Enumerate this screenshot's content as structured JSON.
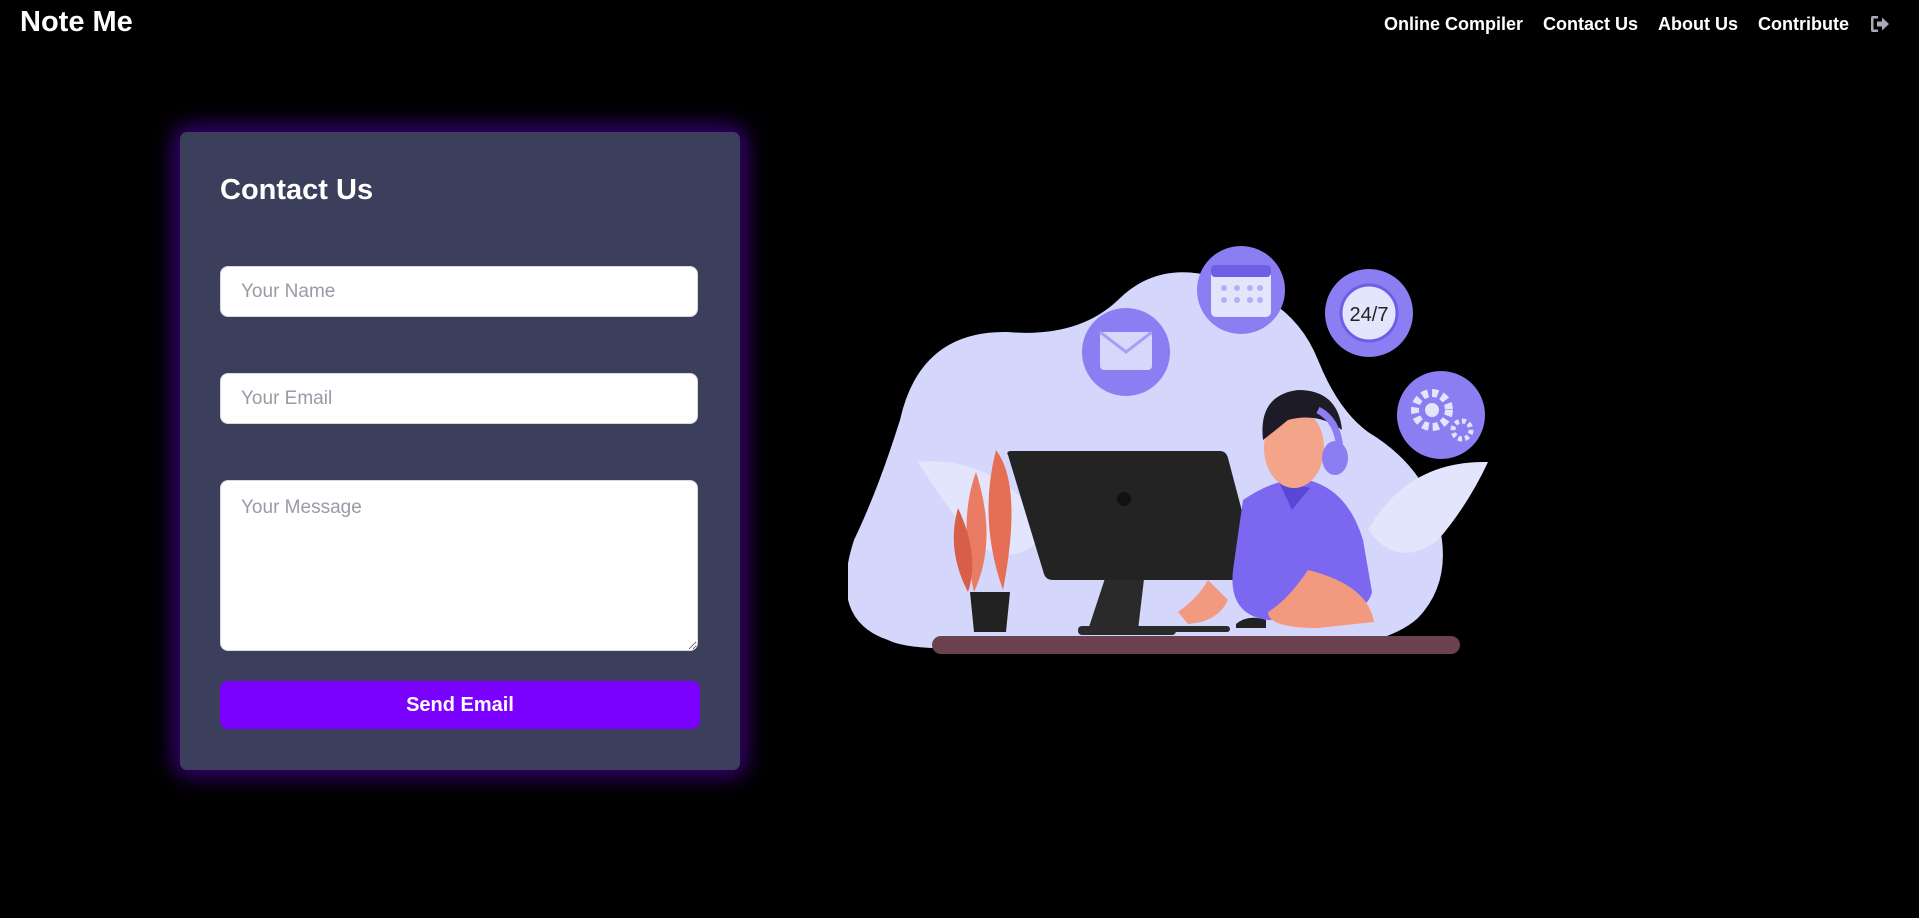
{
  "header": {
    "brand": "Note Me",
    "nav": [
      {
        "label": "Online Compiler"
      },
      {
        "label": "Contact Us"
      },
      {
        "label": "About Us"
      },
      {
        "label": "Contribute"
      }
    ],
    "logout_icon": "sign-out-icon"
  },
  "contact_form": {
    "title": "Contact Us",
    "name_placeholder": "Your Name",
    "email_placeholder": "Your Email",
    "message_placeholder": "Your Message",
    "submit_label": "Send Email"
  },
  "illustration": {
    "badge_text": "24/7"
  },
  "colors": {
    "background": "#000000",
    "card": "#3b3f5c",
    "accent": "#7a00ff",
    "illustration_purple": "#8a7ef2",
    "illustration_blob": "#d4d7fb"
  }
}
